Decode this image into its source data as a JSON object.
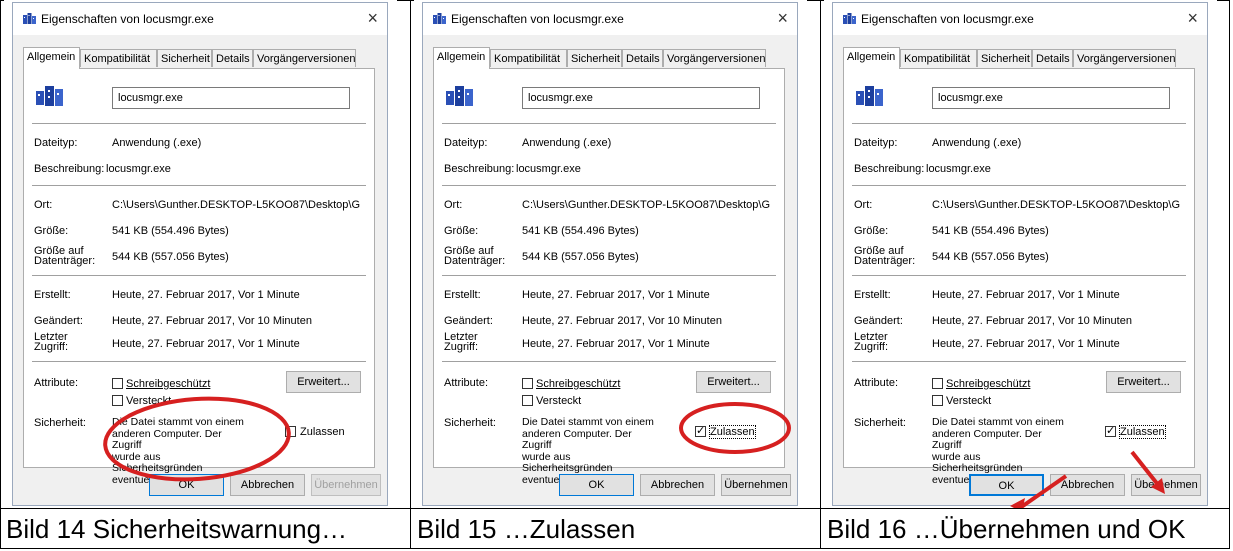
{
  "dialog": {
    "title": "Eigenschaften von locusmgr.exe",
    "close_glyph": "×",
    "tabs": [
      "Allgemein",
      "Kompatibilität",
      "Sicherheit",
      "Details",
      "Vorgängerversionen"
    ],
    "file_name": "locusmgr.exe",
    "labels": {
      "dateityp": "Dateityp:",
      "beschreibung": "Beschreibung:",
      "ort": "Ort:",
      "groesse": "Größe:",
      "groesse_auf_1": "Größe auf",
      "groesse_auf_2": "Datenträger:",
      "erstellt": "Erstellt:",
      "geaendert": "Geändert:",
      "letzter_1": "Letzter",
      "letzter_2": "Zugriff:",
      "attribute": "Attribute:",
      "sicherheit": "Sicherheit:"
    },
    "values": {
      "dateityp": "Anwendung (.exe)",
      "beschreibung": "locusmgr.exe",
      "ort": "C:\\Users\\Gunther.DESKTOP-L5KOO87\\Desktop\\G",
      "groesse": "541 KB (554.496 Bytes)",
      "groesse_auf": "544 KB (557.056 Bytes)",
      "erstellt": "Heute, 27. Februar 2017, Vor 1 Minute",
      "geaendert": "Heute, 27. Februar 2017, Vor 10 Minuten",
      "letzter_zugriff": "Heute, 27. Februar 2017, Vor 1 Minute"
    },
    "attributes": {
      "schreibgeschuetzt": "Schreibgeschützt",
      "versteckt": "Versteckt",
      "erweitert_button": "Erweitert..."
    },
    "security": {
      "text_lines": [
        "Die Datei stammt von einem",
        "anderen Computer. Der Zugriff",
        "wurde aus Sicherheitsgründen",
        "eventuell blockiert."
      ],
      "zulassen": "Zulassen"
    },
    "buttons": {
      "ok": "OK",
      "abbrechen": "Abbrechen",
      "uebernehmen": "Übernehmen"
    }
  },
  "panels": [
    {
      "caption": "Bild 14  Sicherheitswarnung…",
      "zulassen_checked": false,
      "uebernehmen_enabled": false
    },
    {
      "caption": "Bild 15  …Zulassen",
      "zulassen_checked": true,
      "uebernehmen_enabled": true
    },
    {
      "caption": "Bild 16  …Übernehmen und OK",
      "zulassen_checked": true,
      "uebernehmen_enabled": true
    }
  ],
  "colors": {
    "annotation": "#d62020",
    "default_button_border": "#0078d7",
    "dialog_background": "#f0f0f0"
  }
}
